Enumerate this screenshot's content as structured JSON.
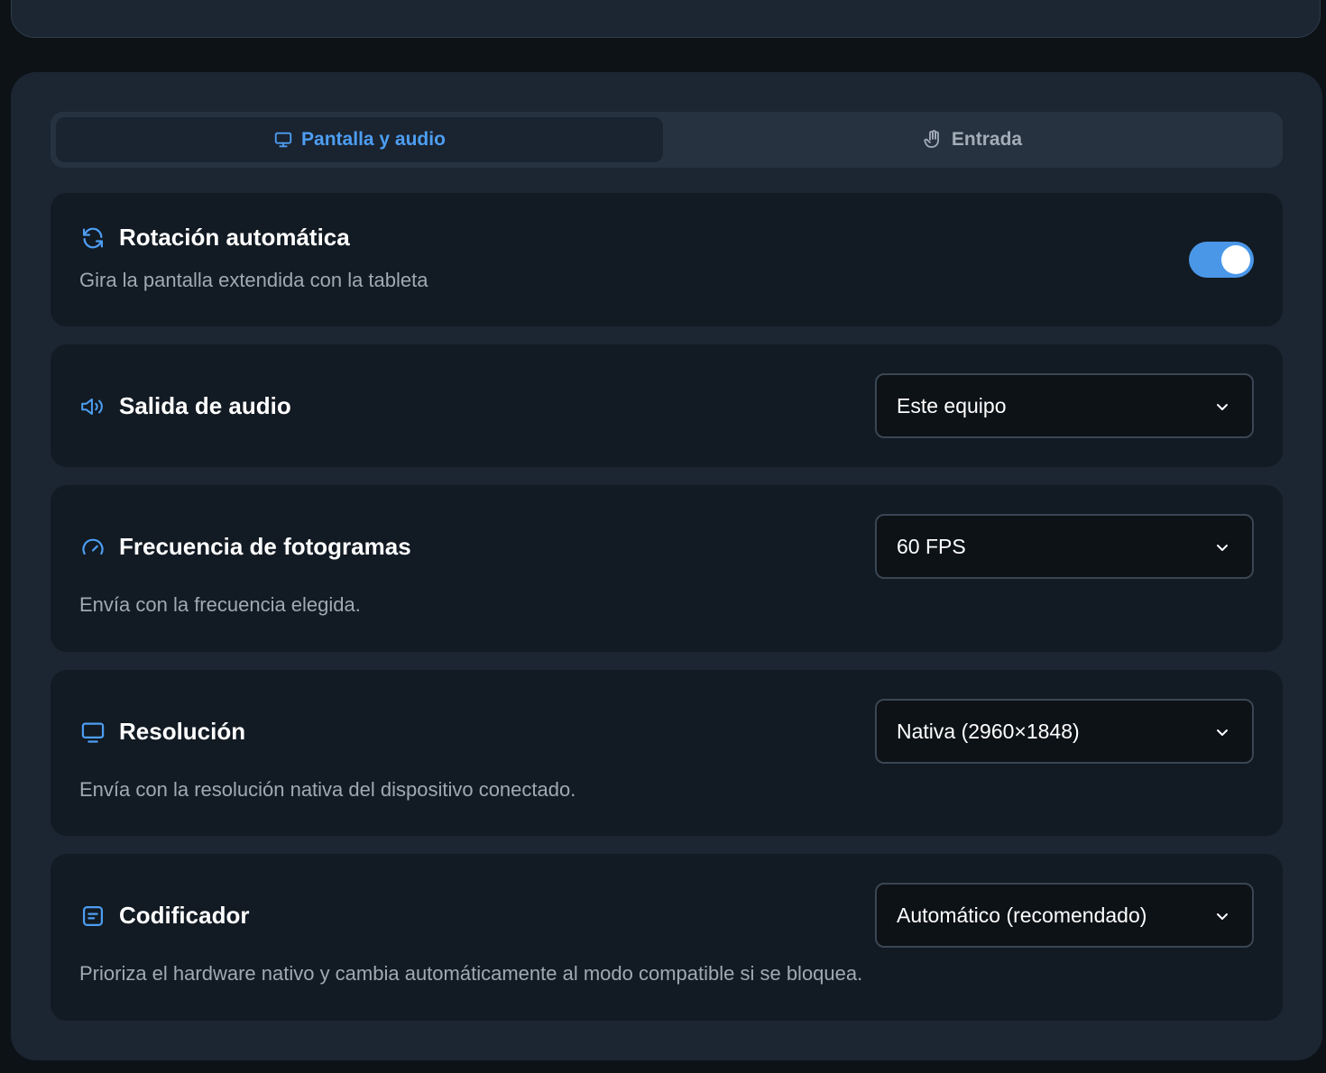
{
  "tabs": [
    {
      "label": "Pantalla y audio",
      "icon": "monitor-icon",
      "active": true
    },
    {
      "label": "Entrada",
      "icon": "hand-pointer-icon",
      "active": false
    }
  ],
  "settings": {
    "rotation": {
      "title": "Rotación automática",
      "description": "Gira la pantalla extendida con la tableta",
      "icon": "rotate-icon",
      "enabled": true
    },
    "audio": {
      "title": "Salida de audio",
      "icon": "speaker-icon",
      "value": "Este equipo"
    },
    "framerate": {
      "title": "Frecuencia de fotogramas",
      "description": "Envía con la frecuencia elegida.",
      "icon": "gauge-icon",
      "value": "60 FPS"
    },
    "resolution": {
      "title": "Resolución",
      "description": "Envía con la resolución nativa del dispositivo conectado.",
      "icon": "display-icon",
      "value": "Nativa (2960×1848)"
    },
    "encoder": {
      "title": "Codificador",
      "description": "Prioriza el hardware nativo y cambia automáticamente al modo compatible si se bloquea.",
      "icon": "encoder-icon",
      "value": "Automático (recomendado)"
    }
  },
  "colors": {
    "accent": "#4d9ef2",
    "toggle_on": "#4a97e8",
    "background": "#0d1217",
    "panel": "#1c2632",
    "card": "#121a23"
  }
}
